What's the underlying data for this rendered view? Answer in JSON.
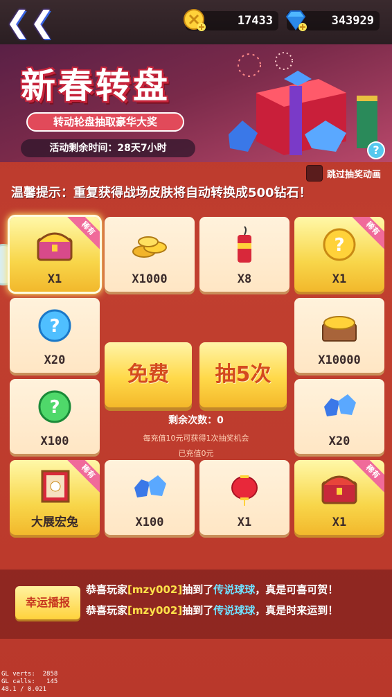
{
  "header": {
    "back_icon": "back-arrow-icon",
    "coins": "17433",
    "gems": "343929"
  },
  "banner": {
    "title": "新春转盘",
    "subtitle": "转动轮盘抽取豪华大奖",
    "time_left": "活动剩余时间：28天7小时"
  },
  "skip_label": "跳过抽奖动画",
  "tip": "温馨提示：重复获得战场皮肤将自动转换成500钻石！",
  "ribbon_text": "稀有",
  "cards": [
    {
      "label": "X1",
      "icon": "treasure-chest-icon",
      "rare": true
    },
    {
      "label": "X1000",
      "icon": "gold-coins-icon",
      "rare": false
    },
    {
      "label": "X8",
      "icon": "firecracker-icon",
      "rare": false
    },
    {
      "label": "X1",
      "icon": "mystery-ball-icon",
      "rare": true
    },
    {
      "label": "X20",
      "icon": "blue-ball-icon",
      "rare": false
    },
    {
      "label": "X10000",
      "icon": "coin-chest-icon",
      "rare": false
    },
    {
      "label": "X100",
      "icon": "green-ball-icon",
      "rare": false
    },
    {
      "label": "X20",
      "icon": "diamonds-icon",
      "rare": false
    },
    {
      "label": "大展宏兔",
      "icon": "rabbit-frame-icon",
      "rare": true
    },
    {
      "label": "X100",
      "icon": "diamonds-icon",
      "rare": false
    },
    {
      "label": "X1",
      "icon": "lantern-icon",
      "rare": false
    },
    {
      "label": "X1",
      "icon": "red-chest-icon",
      "rare": true
    }
  ],
  "buttons": {
    "free": "免费",
    "draw5": "抽5次"
  },
  "remain": "剩余次数：0",
  "recharge_rule": "每充值10元可获得1次抽奖机会",
  "recharged": "已充值0元",
  "news": {
    "button": "幸运播报",
    "lines": [
      {
        "pre": "恭喜玩家",
        "player": "[mzy002]",
        "mid": "抽到了",
        "item": "传说球球",
        "post": "，真是可喜可贺！"
      },
      {
        "pre": "恭喜玩家",
        "player": "[mzy002]",
        "mid": "抽到了",
        "item": "传说球球",
        "post": "，真是时来运到！"
      }
    ]
  },
  "debug": "GL verts:  2858\nGL calls:   145\n48.1 / 0.021"
}
